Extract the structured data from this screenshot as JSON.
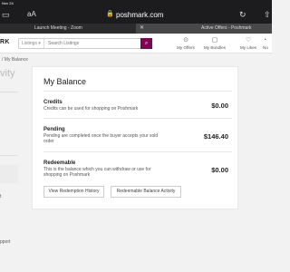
{
  "browser": {
    "status_time": "Nov 24",
    "text_size_label": "aA",
    "domain": "poshmark.com",
    "tabs": [
      {
        "title": "Launch Meeting - Zoom"
      },
      {
        "title": "Active Offers - Poshmark"
      }
    ]
  },
  "header": {
    "logo_text": "RK",
    "search_category": "Listings",
    "search_placeholder": "Search Listings",
    "nav": [
      {
        "label": "My Offers"
      },
      {
        "label": "My Bundles"
      },
      {
        "label": "My Likes"
      },
      {
        "label": "No"
      }
    ]
  },
  "breadcrumb": "/  My Balance",
  "sidebar": {
    "title_fragment": "vity",
    "links": [
      {
        "label": "t"
      },
      {
        "label": "pport"
      }
    ]
  },
  "balance": {
    "title": "My Balance",
    "rows": [
      {
        "title": "Credits",
        "description": "Credits can be used for shopping on Poshmark",
        "amount": "$0.00"
      },
      {
        "title": "Pending",
        "description": "Pending are completed once the buyer accepts your sold order",
        "amount": "$146.40"
      },
      {
        "title": "Redeemable",
        "description": "This is the balance which you can withdraw or use for shopping on Poshmark",
        "amount": "$0.00"
      }
    ],
    "buttons": {
      "history": "View Redemption History",
      "activity": "Redeemable Balance Activity"
    }
  },
  "colors": {
    "brand": "#7f0353",
    "browser_chrome": "#1c1c1e"
  }
}
